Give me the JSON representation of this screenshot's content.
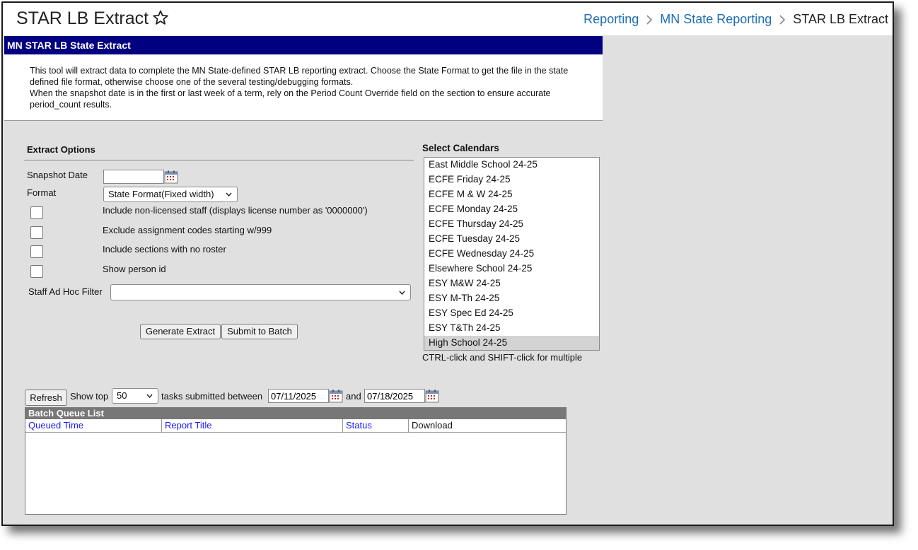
{
  "header": {
    "title": "STAR LB Extract",
    "breadcrumb": [
      "Reporting",
      "MN State Reporting",
      "STAR LB Extract"
    ]
  },
  "panel": {
    "title": "MN STAR LB State Extract",
    "description": [
      "This tool will extract data to complete the MN State-defined STAR LB reporting extract. Choose the State Format to get the file in the state defined file format, otherwise choose one of the several testing/debugging formats.",
      "When the snapshot date is in the first or last week of a term, rely on the Period Count Override field on the section to ensure accurate period_count results."
    ]
  },
  "options": {
    "section_label": "Extract Options",
    "snapshot_label": "Snapshot Date",
    "snapshot_value": "",
    "format_label": "Format",
    "format_value": "State Format(Fixed width)",
    "checkboxes": [
      "Include non-licensed staff (displays license number as '0000000')",
      "Exclude assignment codes starting w/999",
      "Include sections with no roster",
      "Show person id"
    ],
    "adhoc_label": "Staff Ad Hoc Filter",
    "adhoc_value": "",
    "generate_label": "Generate Extract",
    "submit_label": "Submit to Batch"
  },
  "calendars": {
    "label": "Select Calendars",
    "items": [
      "East Middle School 24-25",
      "ECFE Friday 24-25",
      "ECFE M & W 24-25",
      "ECFE Monday 24-25",
      "ECFE Thursday 24-25",
      "ECFE Tuesday 24-25",
      "ECFE Wednesday 24-25",
      "Elsewhere School 24-25",
      "ESY M&W 24-25",
      "ESY M-Th 24-25",
      "ESY Spec Ed 24-25",
      "ESY T&Th 24-25",
      "High School 24-25"
    ],
    "selected": "High School 24-25",
    "hint": "CTRL-click and SHIFT-click for multiple"
  },
  "batch": {
    "refresh_label": "Refresh",
    "show_top_label": "Show top",
    "show_top_value": "50",
    "between_label": "tasks submitted between",
    "start_date": "07/11/2025",
    "and_label": "and",
    "end_date": "07/18/2025",
    "caption": "Batch Queue List",
    "columns": [
      "Queued Time",
      "Report Title",
      "Status",
      "Download"
    ]
  },
  "colors": {
    "panel_header": "#000080",
    "link": "#1f6fb2",
    "column_link": "#1a1aff",
    "selected_row": "#d3d3d3"
  }
}
